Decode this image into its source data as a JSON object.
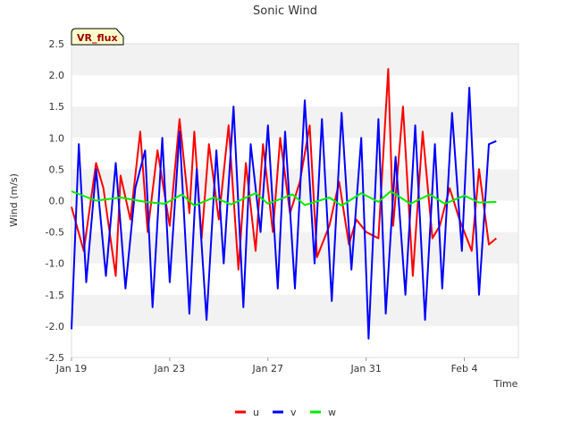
{
  "chart_data": {
    "type": "line",
    "title": "Sonic Wind",
    "xlabel": "Time",
    "ylabel": "Wind (m/s)",
    "site_label": "VR_flux",
    "x_range": [
      "2024-01-19",
      "2024-02-06"
    ],
    "ylim": [
      -2.5,
      2.5
    ],
    "y_ticks": [
      -2.5,
      -2.0,
      -1.5,
      -1.0,
      -0.5,
      0.0,
      0.5,
      1.0,
      1.5,
      2.0,
      2.5
    ],
    "y_tick_labels": [
      "-2.5",
      "-2.0",
      "-1.5",
      "-1.0",
      "-0.5",
      "0.0",
      "0.5",
      "1.0",
      "1.5",
      "2.0",
      "2.5"
    ],
    "x_ticks": [
      0,
      4,
      8,
      12,
      16
    ],
    "x_tick_labels": [
      "Jan 19",
      "Jan 23",
      "Jan 27",
      "Jan 31",
      "Feb 4"
    ],
    "grid": "horizontal bands",
    "legend_position": "bottom-center",
    "series": [
      {
        "name": "u",
        "color": "#ff0000",
        "x": [
          0.0,
          0.5,
          1.0,
          1.3,
          1.8,
          2.0,
          2.4,
          2.8,
          3.1,
          3.5,
          4.0,
          4.4,
          4.8,
          5.0,
          5.3,
          5.6,
          6.0,
          6.4,
          6.8,
          7.1,
          7.5,
          7.8,
          8.2,
          8.5,
          8.9,
          9.3,
          9.7,
          10.0,
          10.5,
          10.9,
          11.3,
          11.6,
          12.0,
          12.5,
          12.9,
          13.1,
          13.5,
          13.9,
          14.3,
          14.7,
          15.0,
          15.4,
          15.8,
          16.3,
          16.6,
          17.0,
          17.3
        ],
        "y": [
          -0.1,
          -0.8,
          0.6,
          0.2,
          -1.2,
          0.4,
          -0.3,
          1.1,
          -0.5,
          0.8,
          -0.4,
          1.3,
          -0.2,
          1.1,
          -0.6,
          0.9,
          -0.3,
          1.2,
          -1.1,
          0.6,
          -0.8,
          0.9,
          -0.5,
          1.0,
          -0.2,
          0.3,
          1.2,
          -0.9,
          -0.4,
          0.3,
          -0.7,
          -0.3,
          -0.5,
          -0.6,
          2.1,
          -0.4,
          1.5,
          -1.2,
          1.1,
          -0.6,
          -0.4,
          0.2,
          -0.3,
          -0.8,
          0.5,
          -0.7,
          -0.6
        ]
      },
      {
        "name": "v",
        "color": "#0000ff",
        "x": [
          0.0,
          0.3,
          0.6,
          1.0,
          1.4,
          1.8,
          2.2,
          2.6,
          3.0,
          3.3,
          3.7,
          4.0,
          4.4,
          4.8,
          5.1,
          5.5,
          5.9,
          6.2,
          6.6,
          7.0,
          7.3,
          7.7,
          8.0,
          8.4,
          8.7,
          9.1,
          9.5,
          9.9,
          10.2,
          10.6,
          11.0,
          11.4,
          11.8,
          12.1,
          12.5,
          12.8,
          13.2,
          13.6,
          14.0,
          14.4,
          14.8,
          15.1,
          15.5,
          15.9,
          16.2,
          16.6,
          17.0,
          17.3
        ],
        "y": [
          -2.05,
          0.9,
          -1.3,
          0.5,
          -1.2,
          0.6,
          -1.4,
          0.2,
          0.8,
          -1.7,
          1.0,
          -1.3,
          1.1,
          -1.8,
          0.5,
          -1.9,
          0.8,
          -1.0,
          1.5,
          -1.7,
          0.9,
          -0.5,
          1.2,
          -1.4,
          1.1,
          -1.4,
          1.6,
          -1.0,
          1.3,
          -1.6,
          1.4,
          -1.1,
          1.0,
          -2.2,
          1.3,
          -1.8,
          0.7,
          -1.5,
          1.2,
          -1.9,
          0.9,
          -1.4,
          1.4,
          -0.8,
          1.8,
          -1.5,
          0.9,
          0.95
        ]
      },
      {
        "name": "w",
        "color": "#00ee00",
        "x": [
          0.0,
          1.0,
          2.0,
          3.0,
          3.8,
          4.5,
          5.0,
          5.8,
          6.5,
          7.5,
          8.0,
          9.0,
          9.5,
          10.5,
          11.0,
          11.8,
          12.5,
          13.0,
          13.8,
          14.6,
          15.2,
          16.0,
          16.6,
          17.3
        ],
        "y": [
          0.15,
          0.0,
          0.05,
          -0.02,
          -0.05,
          0.1,
          -0.08,
          0.05,
          -0.06,
          0.12,
          -0.05,
          0.1,
          -0.07,
          0.05,
          -0.08,
          0.12,
          -0.02,
          0.15,
          -0.05,
          0.1,
          -0.05,
          0.08,
          -0.03,
          -0.02
        ]
      }
    ]
  }
}
